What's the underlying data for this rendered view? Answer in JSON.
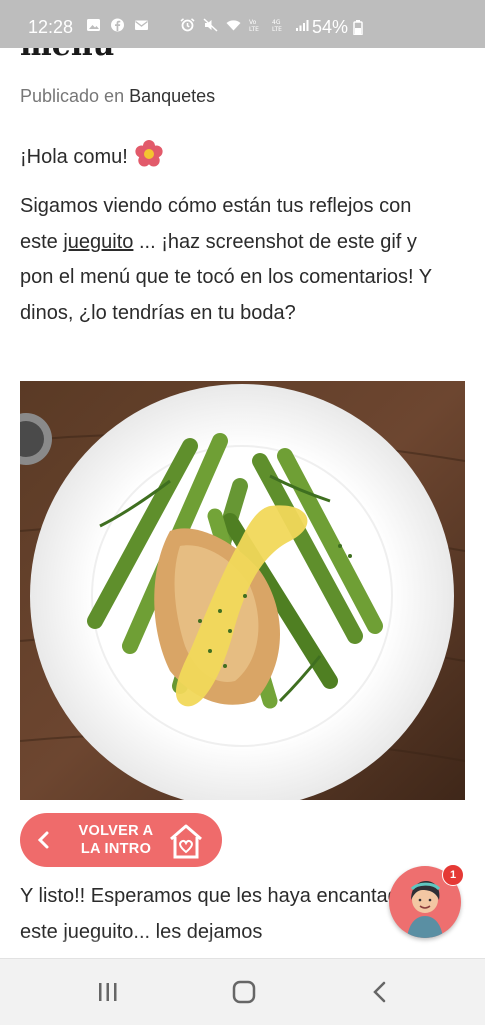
{
  "status_bar": {
    "time": "12:28",
    "battery": "54%",
    "icons": [
      "image-icon",
      "facebook-icon",
      "mail-icon",
      "alarm-icon",
      "mute-icon",
      "wifi-icon",
      "volte-icon",
      "4g-icon",
      "signal-icon",
      "battery-icon"
    ]
  },
  "article": {
    "title_partial": "menú",
    "published_prefix": "Publicado en",
    "category": "Banquetes",
    "greeting": "¡Hola comu!",
    "body_before_link": "Sigamos viendo cómo están tus reflejos con este ",
    "link_text": "jueguito",
    "body_after_link": " ... ¡haz screenshot de este gif y pon el menú que te tocó en los comentarios! Y dinos, ¿lo tendrías en tu boda?",
    "image_alt": "chicken-asparagus-dish",
    "closing_text": "Y listo!! Esperamos que les haya encantado este jueguito... les dejamos"
  },
  "back_button": {
    "label": "VOLVER A LA INTRO"
  },
  "chat_button": {
    "badge_count": "1"
  },
  "colors": {
    "accent": "#ef6b6b",
    "badge": "#e53935",
    "status_bar": "#bdbdbd"
  }
}
